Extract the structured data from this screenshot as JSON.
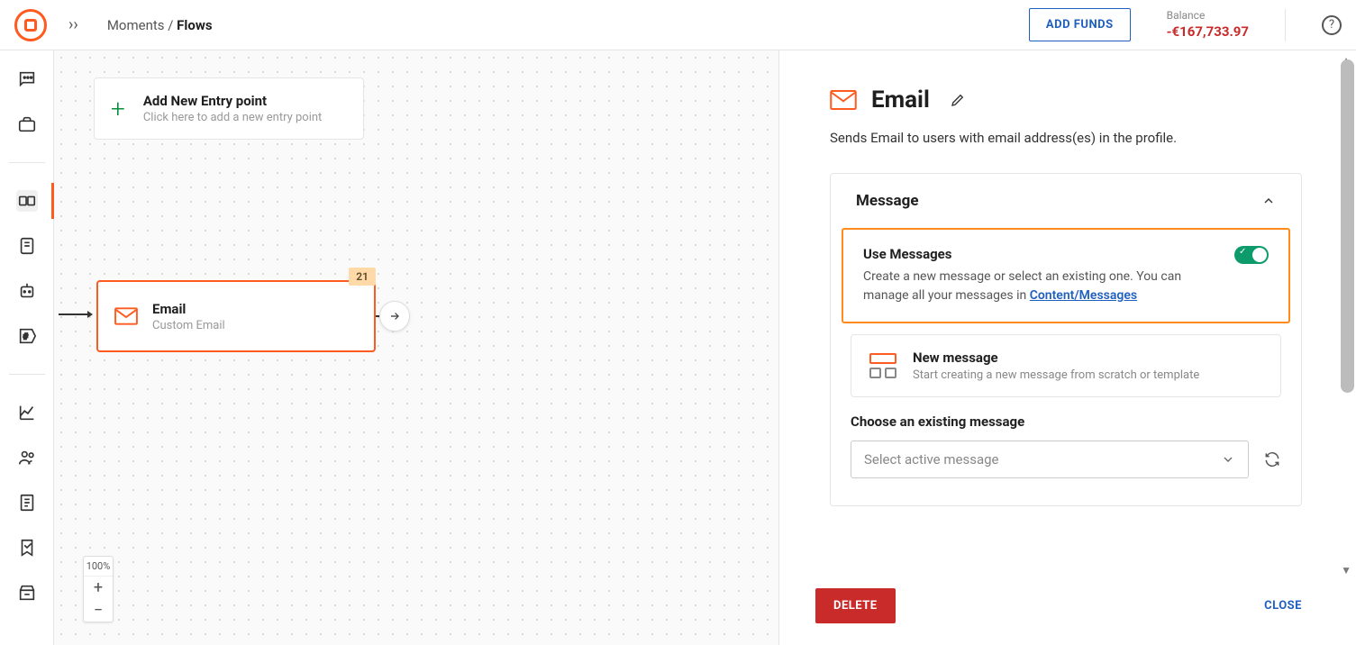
{
  "breadcrumb": {
    "root": "Moments",
    "current": "Flows"
  },
  "header": {
    "add_funds": "ADD FUNDS",
    "balance_label": "Balance",
    "balance_amount": "-€167,733.97"
  },
  "canvas": {
    "entry": {
      "title": "Add New Entry point",
      "sub": "Click here to add a new entry point"
    },
    "email_node": {
      "title": "Email",
      "sub": "Custom Email",
      "badge": "21"
    },
    "zoom": "100%"
  },
  "panel": {
    "title": "Email",
    "desc": "Sends Email to users with email address(es) in the profile.",
    "section_title": "Message",
    "use_msg": {
      "title": "Use Messages",
      "desc_pre": "Create a new message or select an existing one. You can manage all your messages in ",
      "link": "Content/Messages"
    },
    "new_msg": {
      "title": "New message",
      "sub": "Start creating a new message from scratch or template"
    },
    "choose_label": "Choose an existing message",
    "select_placeholder": "Select active message",
    "delete": "DELETE",
    "close": "CLOSE"
  }
}
